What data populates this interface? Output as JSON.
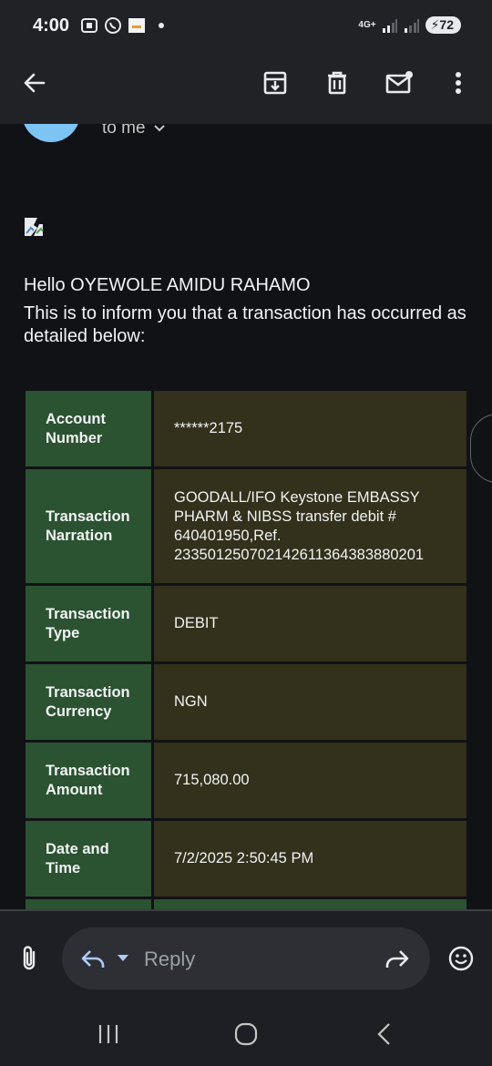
{
  "status_bar": {
    "time": "4:00",
    "network": "4G+",
    "battery": "72"
  },
  "icons": {
    "back": "arrow-left-icon",
    "archive": "archive-icon",
    "delete": "trash-icon",
    "mark_unread": "mail-unread-icon",
    "more": "more-vert-icon",
    "attach": "paperclip-icon",
    "reply": "reply-icon",
    "forward": "forward-icon",
    "emoji": "emoji-icon"
  },
  "email": {
    "recipient": "to me",
    "greeting": "Hello OYEWOLE AMIDU RAHAMO",
    "intro": "This is to inform you that a transaction has occurred as detailed below:",
    "rows": [
      {
        "label": "Account Number",
        "value": "******2175"
      },
      {
        "label": "Transaction Narration",
        "value": "GOODALL/IFO Keystone EMBASSY PHARM & NIBSS transfer debit # 640401950,Ref. 233501250702142611364383880201"
      },
      {
        "label": "Transaction Type",
        "value": "DEBIT"
      },
      {
        "label": "Transaction Currency",
        "value": "NGN"
      },
      {
        "label": "Transaction Amount",
        "value": "715,080.00"
      },
      {
        "label": "Date and Time",
        "value": "7/2/2025 2:50:45 PM"
      }
    ]
  },
  "reply_bar": {
    "reply_label": "Reply"
  },
  "colors": {
    "label_bg": "#2b5231",
    "value_bg": "#33301b",
    "avatar": "#7cc4f4"
  }
}
